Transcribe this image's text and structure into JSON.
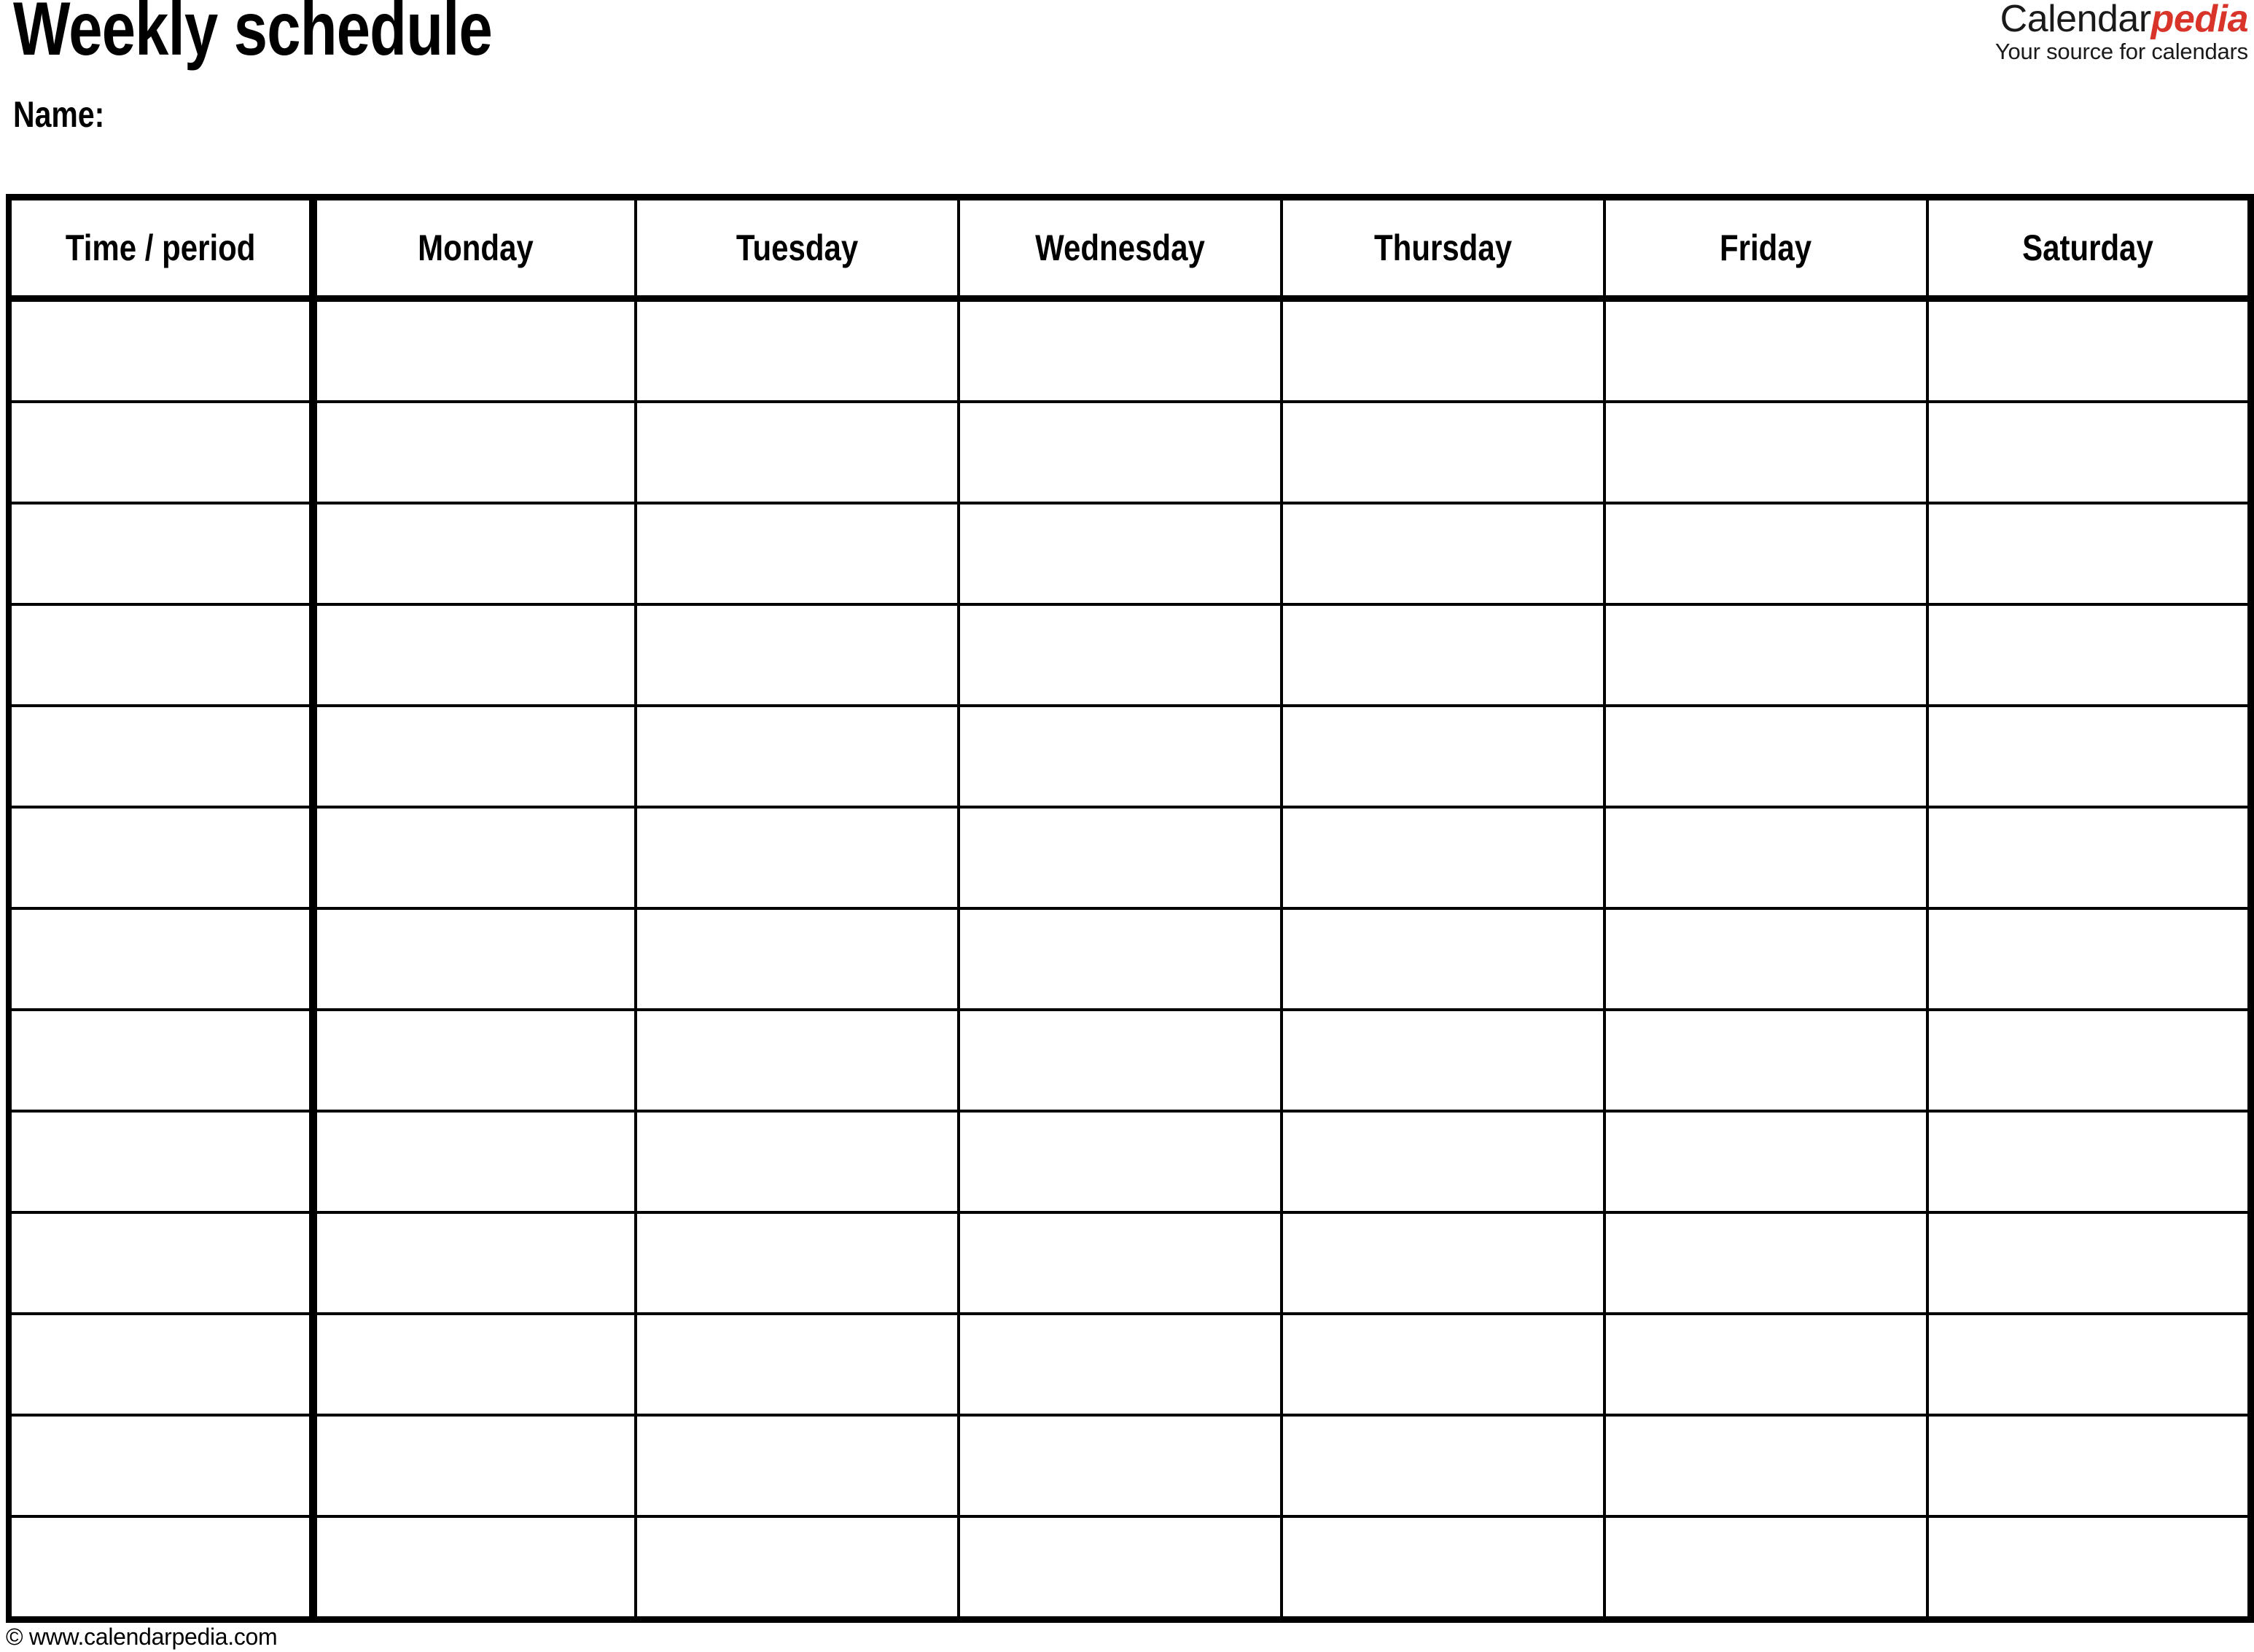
{
  "document": {
    "title": "Weekly schedule",
    "name_label": "Name:"
  },
  "brand": {
    "word_primary": "Calendar",
    "word_accent": "pedia",
    "tagline": "Your source for calendars",
    "accent_color": "#d9342a",
    "primary_color": "#1a1a1a"
  },
  "table": {
    "columns": [
      {
        "key": "time",
        "label": "Time / period"
      },
      {
        "key": "monday",
        "label": "Monday"
      },
      {
        "key": "tuesday",
        "label": "Tuesday"
      },
      {
        "key": "wednesday",
        "label": "Wednesday"
      },
      {
        "key": "thursday",
        "label": "Thursday"
      },
      {
        "key": "friday",
        "label": "Friday"
      },
      {
        "key": "saturday",
        "label": "Saturday"
      }
    ],
    "row_count": 13,
    "rows": [
      {
        "time": "",
        "monday": "",
        "tuesday": "",
        "wednesday": "",
        "thursday": "",
        "friday": "",
        "saturday": ""
      },
      {
        "time": "",
        "monday": "",
        "tuesday": "",
        "wednesday": "",
        "thursday": "",
        "friday": "",
        "saturday": ""
      },
      {
        "time": "",
        "monday": "",
        "tuesday": "",
        "wednesday": "",
        "thursday": "",
        "friday": "",
        "saturday": ""
      },
      {
        "time": "",
        "monday": "",
        "tuesday": "",
        "wednesday": "",
        "thursday": "",
        "friday": "",
        "saturday": ""
      },
      {
        "time": "",
        "monday": "",
        "tuesday": "",
        "wednesday": "",
        "thursday": "",
        "friday": "",
        "saturday": ""
      },
      {
        "time": "",
        "monday": "",
        "tuesday": "",
        "wednesday": "",
        "thursday": "",
        "friday": "",
        "saturday": ""
      },
      {
        "time": "",
        "monday": "",
        "tuesday": "",
        "wednesday": "",
        "thursday": "",
        "friday": "",
        "saturday": ""
      },
      {
        "time": "",
        "monday": "",
        "tuesday": "",
        "wednesday": "",
        "thursday": "",
        "friday": "",
        "saturday": ""
      },
      {
        "time": "",
        "monday": "",
        "tuesday": "",
        "wednesday": "",
        "thursday": "",
        "friday": "",
        "saturday": ""
      },
      {
        "time": "",
        "monday": "",
        "tuesday": "",
        "wednesday": "",
        "thursday": "",
        "friday": "",
        "saturday": ""
      },
      {
        "time": "",
        "monday": "",
        "tuesday": "",
        "wednesday": "",
        "thursday": "",
        "friday": "",
        "saturday": ""
      },
      {
        "time": "",
        "monday": "",
        "tuesday": "",
        "wednesday": "",
        "thursday": "",
        "friday": "",
        "saturday": ""
      },
      {
        "time": "",
        "monday": "",
        "tuesday": "",
        "wednesday": "",
        "thursday": "",
        "friday": "",
        "saturday": ""
      }
    ]
  },
  "footer": {
    "copyright": "© www.calendarpedia.com"
  }
}
